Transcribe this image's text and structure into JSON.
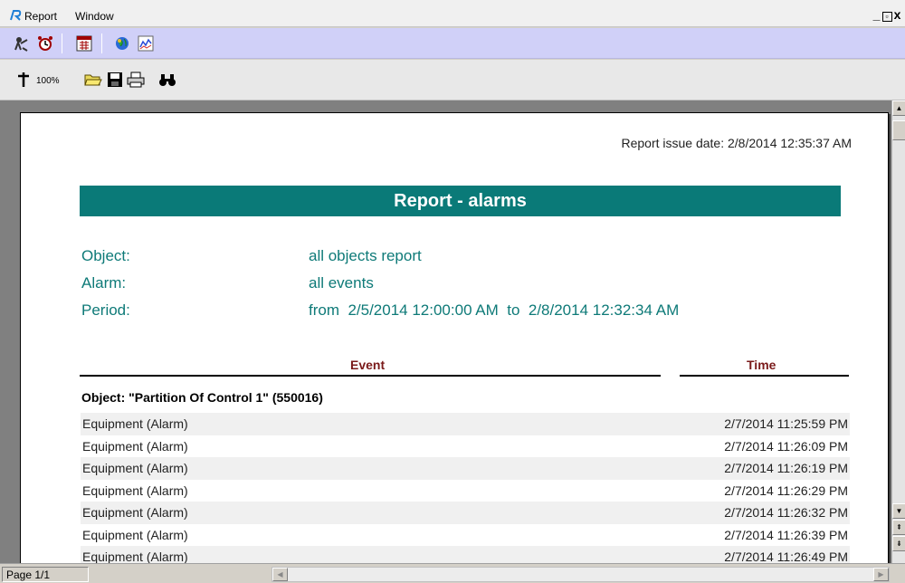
{
  "menu": {
    "items": [
      "Report",
      "Window"
    ]
  },
  "window_controls": [
    "_",
    "▫",
    "x"
  ],
  "toolbar1": {
    "icons": [
      "user-icon",
      "alarm-clock-icon",
      "calendar-icon",
      "globe-icon",
      "chart-icon"
    ]
  },
  "toolbar2": {
    "zoom": "100%",
    "icons": [
      "zoom-icon",
      "open-folder-icon",
      "save-icon",
      "print-icon",
      "find-icon"
    ]
  },
  "report": {
    "issue_date": "Report issue date: 2/8/2014 12:35:37 AM",
    "title": "Report - alarms",
    "meta": [
      {
        "label": "Object:",
        "value": "all objects report"
      },
      {
        "label": "Alarm:",
        "value": "all events"
      },
      {
        "label": "Period:",
        "value": "from  2/5/2014 12:00:00 AM  to  2/8/2014 12:32:34 AM"
      }
    ],
    "columns": {
      "event": "Event",
      "time": "Time"
    },
    "group_title": "Object: \"Partition Of Control 1\" (550016)",
    "rows": [
      {
        "event": "Equipment (Alarm)",
        "time": "2/7/2014 11:25:59 PM"
      },
      {
        "event": "Equipment (Alarm)",
        "time": "2/7/2014 11:26:09 PM"
      },
      {
        "event": "Equipment (Alarm)",
        "time": "2/7/2014 11:26:19 PM"
      },
      {
        "event": "Equipment (Alarm)",
        "time": "2/7/2014 11:26:29 PM"
      },
      {
        "event": "Equipment (Alarm)",
        "time": "2/7/2014 11:26:32 PM"
      },
      {
        "event": "Equipment (Alarm)",
        "time": "2/7/2014 11:26:39 PM"
      },
      {
        "event": "Equipment (Alarm)",
        "time": "2/7/2014 11:26:49 PM"
      }
    ]
  },
  "status": {
    "page": "Page 1/1"
  },
  "colors": {
    "accent": "#0a7a78",
    "header_text": "#7a1a1a",
    "toolbar_bg": "#d0d0f8"
  }
}
